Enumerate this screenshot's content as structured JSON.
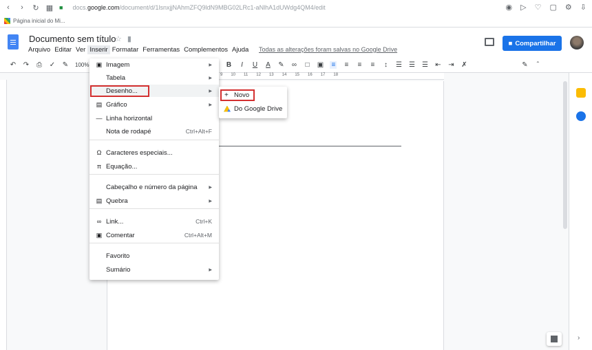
{
  "browser": {
    "url_prefix": "docs.",
    "url_domain": "google.com",
    "url_path": "/document/d/1lsnxjjNAhmZFQ9ldN9MBG02LRc1-aNlhA1dUWdg4QM4/edit",
    "bookmark": "Página inicial do Mi..."
  },
  "docs": {
    "title": "Documento sem título",
    "menu": [
      "Arquivo",
      "Editar",
      "Ver",
      "Inserir",
      "Formatar",
      "Ferramentas",
      "Complementos",
      "Ajuda"
    ],
    "saved_status": "Todas as alterações foram salvas no Google Drive",
    "share_label": "Compartilhar",
    "zoom": "100%"
  },
  "ruler_numbers": [
    "9",
    "10",
    "11",
    "12",
    "13",
    "14",
    "15",
    "16",
    "17",
    "18"
  ],
  "insert_menu": {
    "imagem": "Imagem",
    "tabela": "Tabela",
    "desenho": "Desenho...",
    "grafico": "Gráfico",
    "linha": "Linha horizontal",
    "nota": "Nota de rodapé",
    "nota_shortcut": "Ctrl+Alt+F",
    "caracteres": "Caracteres especiais...",
    "equacao": "Equação...",
    "cabecalho": "Cabeçalho e número da página",
    "quebra": "Quebra",
    "link": "Link...",
    "link_shortcut": "Ctrl+K",
    "comentar": "Comentar",
    "comentar_shortcut": "Ctrl+Alt+M",
    "favorito": "Favorito",
    "sumario": "Sumário"
  },
  "submenu": {
    "novo": "Novo",
    "drive": "Do Google Drive"
  },
  "colors": {
    "accent": "#1a73e8",
    "highlight": "#d32f2f"
  }
}
